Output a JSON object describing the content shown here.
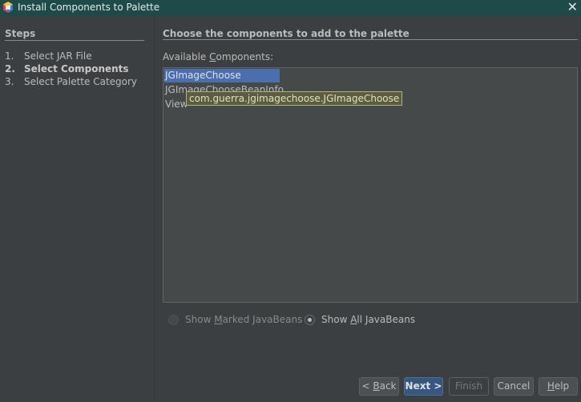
{
  "window": {
    "title": "Install Components to Palette",
    "close_glyph": "✕"
  },
  "steps": {
    "heading": "Steps",
    "items": [
      {
        "num": "1.",
        "label": "Select JAR File",
        "active": false
      },
      {
        "num": "2.",
        "label": "Select Components",
        "active": true
      },
      {
        "num": "3.",
        "label": "Select Palette Category",
        "active": false
      }
    ]
  },
  "main": {
    "heading": "Choose the components to add to the palette",
    "available_label_pre": "Available ",
    "available_label_mnemonic": "C",
    "available_label_post": "omponents:",
    "list_items": [
      "JGImageChoose",
      "JGImageChooseBeanInfo",
      "View"
    ],
    "selected_index": 0,
    "tooltip": "com.guerra.jgimagechoose.JGImageChoose"
  },
  "options": {
    "show_marked": {
      "pre": "Show ",
      "mnemonic": "M",
      "post": "arked JavaBeans",
      "checked": false,
      "enabled": false
    },
    "show_all": {
      "pre": "Show ",
      "mnemonic": "A",
      "post": "ll JavaBeans",
      "checked": true,
      "enabled": true
    }
  },
  "buttons": {
    "back": {
      "pre": "< ",
      "mnemonic": "B",
      "post": "ack"
    },
    "next": "Next >",
    "finish": "Finish",
    "cancel": "Cancel",
    "help": {
      "mnemonic": "H",
      "post": "elp"
    }
  },
  "colors": {
    "titlebar": "#1c4b4a",
    "background": "#3c3f41",
    "selection": "#4b6eaf",
    "tooltip_bg": "#5c5c42",
    "default_button": "#365880"
  }
}
